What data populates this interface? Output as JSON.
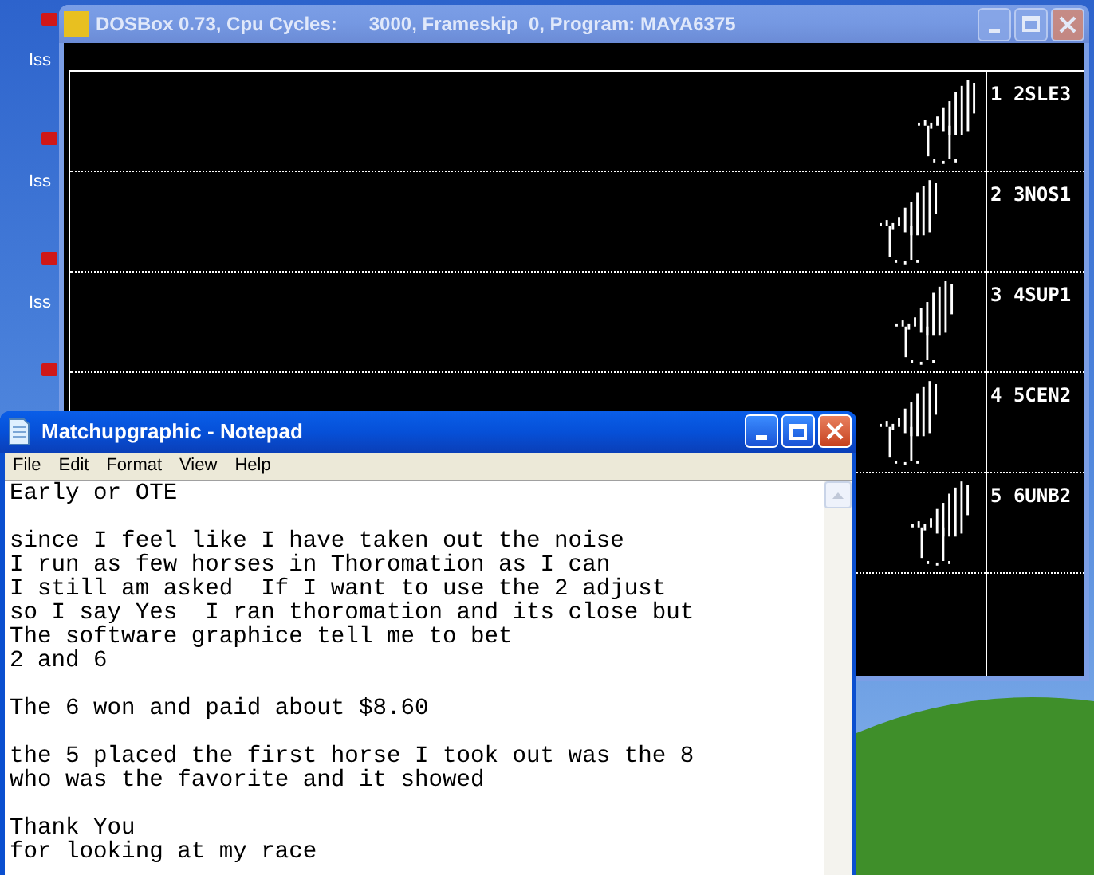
{
  "desktop": {
    "icons": [
      {
        "label": "Iss"
      },
      {
        "label": "Iss"
      },
      {
        "label": "Iss"
      }
    ]
  },
  "dosbox": {
    "title": "DOSBox 0.73, Cpu Cycles:      3000, Frameskip  0, Program: MAYA6375",
    "active": false,
    "rows": [
      {
        "label": "1 2SLE3"
      },
      {
        "label": "2 3NOS1"
      },
      {
        "label": "3 4SUP1"
      },
      {
        "label": "4 5CEN2"
      },
      {
        "label": "5 6UNB2"
      }
    ]
  },
  "notepad": {
    "title": "Matchupgraphic - Notepad",
    "active": true,
    "menu": [
      "File",
      "Edit",
      "Format",
      "View",
      "Help"
    ],
    "paragraphs": [
      [
        "Early or OTE"
      ],
      [
        "since I feel like I have taken out the noise",
        "I run as few horses in Thoromation as I can",
        "I still am asked  If I want to use the 2 adjust",
        "so I say Yes  I ran thoromation and its close but",
        "The software graphice tell me to bet",
        "2 and 6"
      ],
      [
        "The 6 won and paid about $8.60"
      ],
      [
        "the 5 placed the first horse I took out was the 8",
        "who was the favorite and it showed"
      ],
      [
        "Thank You",
        "for looking at my race"
      ]
    ]
  }
}
